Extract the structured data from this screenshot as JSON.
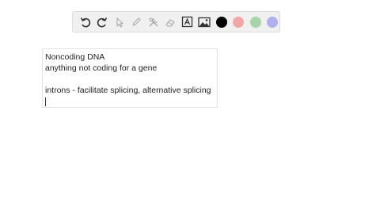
{
  "toolbar": {
    "tools": [
      {
        "name": "undo-icon",
        "label": "Undo"
      },
      {
        "name": "redo-icon",
        "label": "Redo"
      },
      {
        "name": "select-pointer-icon",
        "label": "Select"
      },
      {
        "name": "pen-icon",
        "label": "Pen"
      },
      {
        "name": "tools-icon",
        "label": "Tools"
      },
      {
        "name": "eraser-icon",
        "label": "Eraser"
      },
      {
        "name": "text-tool-icon",
        "label": "Text"
      },
      {
        "name": "image-icon",
        "label": "Image"
      }
    ],
    "colors": {
      "black": "#000000",
      "red": "#f2a7a7",
      "green": "#a9d3a9",
      "blue": "#b0b0ec"
    }
  },
  "note": {
    "lines": [
      "Noncoding DNA",
      "anything not coding for a gene",
      "",
      "introns - facilitate splicing, alternative splicing"
    ]
  }
}
